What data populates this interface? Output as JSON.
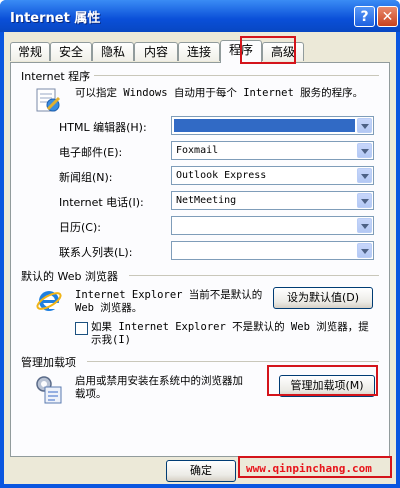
{
  "window": {
    "title": "Internet 属性",
    "help_glyph": "?",
    "close_glyph": "✕"
  },
  "tabs": [
    {
      "label": "常规"
    },
    {
      "label": "安全"
    },
    {
      "label": "隐私"
    },
    {
      "label": "内容"
    },
    {
      "label": "连接"
    },
    {
      "label": "程序"
    },
    {
      "label": "高级"
    }
  ],
  "active_tab": "程序",
  "programs": {
    "group_title": "Internet 程序",
    "description": "可以指定 Windows 自动用于每个 Internet 服务的程序。",
    "rows": [
      {
        "label": "HTML 编辑器(H):",
        "value": ""
      },
      {
        "label": "电子邮件(E):",
        "value": "Foxmail"
      },
      {
        "label": "新闻组(N):",
        "value": "Outlook Express"
      },
      {
        "label": "Internet 电话(I):",
        "value": "NetMeeting"
      },
      {
        "label": "日历(C):",
        "value": ""
      },
      {
        "label": "联系人列表(L):",
        "value": ""
      }
    ]
  },
  "browser": {
    "group_title": "默认的 Web 浏览器",
    "message_line1": "Internet Explorer 当前不是默认的",
    "message_line2": "Web 浏览器。",
    "set_default_button": "设为默认值(D)",
    "check_line1": "如果 Internet Explorer 不是默认的 Web 浏览器，提",
    "check_line2": "示我(I)",
    "checked": false
  },
  "addons": {
    "group_title": "管理加载项",
    "message_line1": "启用或禁用安装在系统中的浏览器加",
    "message_line2": "载项。",
    "manage_button": "管理加载项(M)"
  },
  "footer": {
    "ok_button": "确定"
  },
  "watermark": "www.qinpinchang.com",
  "colors": {
    "title_bar": "#0a4fd8",
    "highlight_box": "#d4141b",
    "selection": "#316ac5",
    "dialog_face": "#ece9d8"
  }
}
